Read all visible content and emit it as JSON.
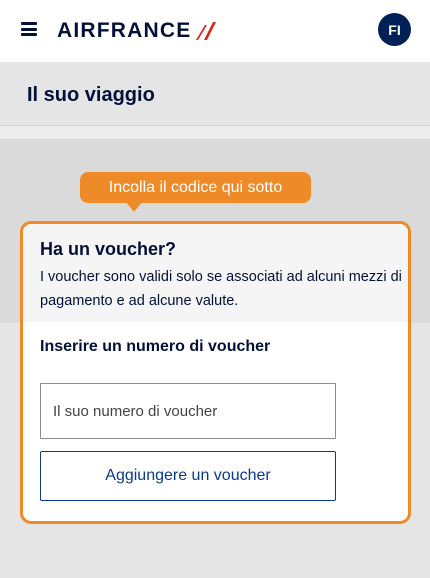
{
  "header": {
    "logo_text": "AIRFRANCE",
    "avatar_initials": "FI",
    "brand_color": "#051039",
    "stripe_color": "#e2231a"
  },
  "page": {
    "title": "Il suo viaggio"
  },
  "tooltip": {
    "text": "Incolla il codice qui sotto",
    "color": "#ef8a29"
  },
  "voucher": {
    "title": "Ha un voucher?",
    "description": "I voucher sono validi solo se associati ad alcuni mezzi di pagamento e ad alcune valute.",
    "field_label": "Inserire un numero di voucher",
    "input_placeholder": "Il suo numero di voucher",
    "input_value": "",
    "button_label": "Aggiungere un voucher"
  },
  "icons": {
    "menu": "hamburger-menu-icon",
    "logo_mark": "air-france-stripe-icon"
  }
}
